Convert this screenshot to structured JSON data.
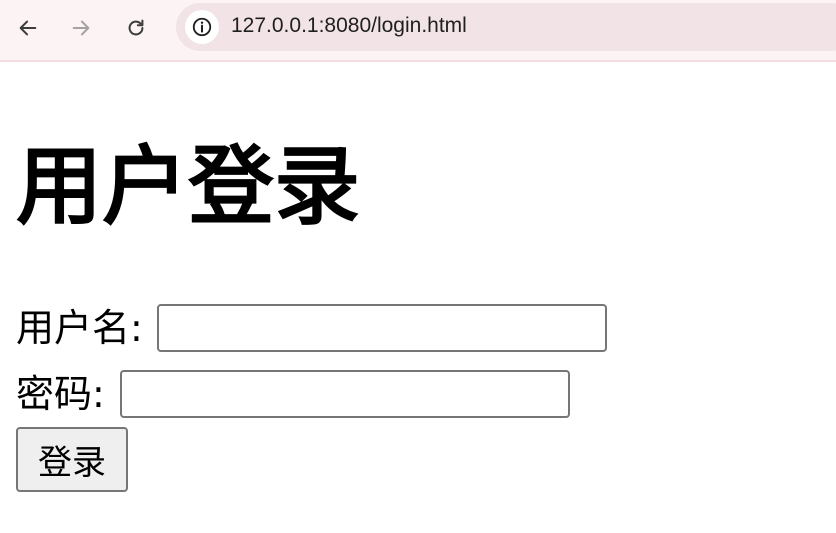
{
  "browser": {
    "url": "127.0.0.1:8080/login.html",
    "icons": {
      "back": "arrow-left-icon",
      "forward": "arrow-right-icon",
      "reload": "reload-icon",
      "site_info": "info-icon"
    }
  },
  "page": {
    "title": "用户登录",
    "form": {
      "username_label": "用户名:",
      "username_value": "",
      "password_label": "密码:",
      "password_value": "",
      "submit_label": "登录"
    }
  },
  "colors": {
    "toolbar_bg": "#fbf3f4",
    "address_bg": "#f1e3e6",
    "input_border": "#767676",
    "button_bg": "#efefef"
  }
}
